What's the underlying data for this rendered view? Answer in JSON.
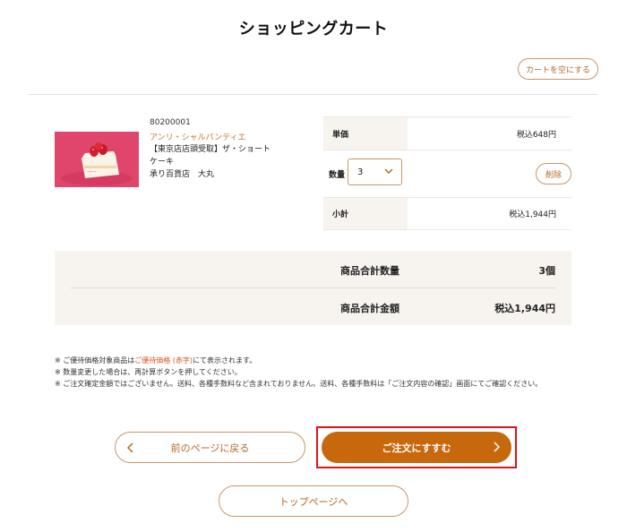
{
  "page": {
    "title": "ショッピングカート"
  },
  "cart": {
    "clear_label": "カートを空にする"
  },
  "item": {
    "code": "80200001",
    "brand": "アンリ・シャルパンティエ",
    "name": "【東京店店頭受取】ザ・ショートケーキ",
    "store": "承り百貨店　大丸",
    "unit_price_label": "単価",
    "unit_price": "税込648円",
    "qty_label": "数量",
    "qty_value": "3",
    "delete_label": "削除",
    "subtotal_label": "小計",
    "subtotal": "税込1,944円"
  },
  "summary": {
    "qty_label": "商品合計数量",
    "qty_value": "3個",
    "total_label": "商品合計金額",
    "total_value": "税込1,944円"
  },
  "notes": {
    "n1_pre": "※ ご優待価格対象商品は",
    "n1_hl": "ご優待価格 (赤字)",
    "n1_post": "にて表示されます。",
    "n2": "※ 数量変更した場合は、再計算ボタンを押してください。",
    "n3": "※ ご注文確定金額ではございません。送料、各種手数料など含まれておりません。送料、各種手数料は「ご注文内容の確認」画面にてご確認ください。"
  },
  "buttons": {
    "back": "前のページに戻る",
    "order": "ご注文にすすむ",
    "top": "トップページへ"
  },
  "colors": {
    "accent": "#c8680d",
    "border": "#c9956a",
    "highlight": "#e0121b",
    "note_red": "#d9531e"
  }
}
